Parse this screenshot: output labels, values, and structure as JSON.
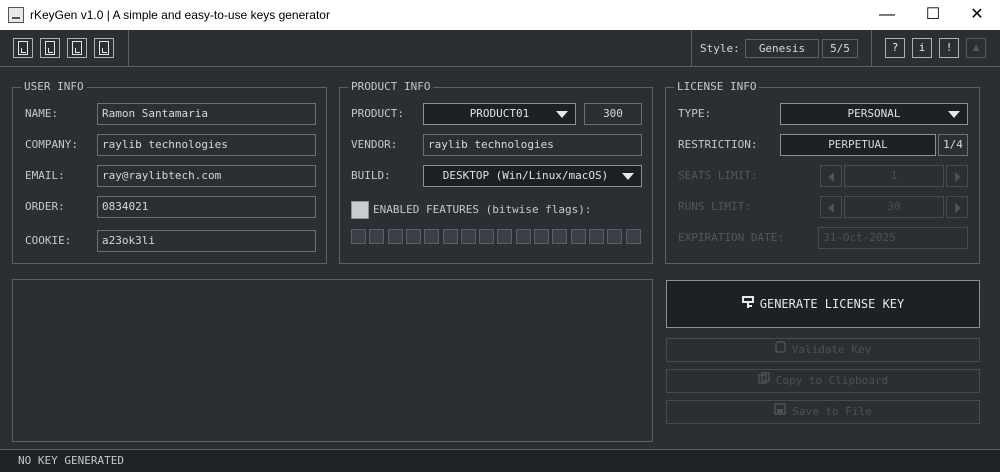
{
  "window": {
    "title": "rKeyGen v1.0 | A simple and easy-to-use keys generator",
    "minimize": "—",
    "maximize": "☐",
    "close": "✕"
  },
  "toolbar": {
    "style_label": "Style:",
    "style_value": "Genesis",
    "style_index": "5/5",
    "help_icon": "?",
    "info_icon": "i",
    "warn_icon": "!"
  },
  "user_info": {
    "title": "USER INFO",
    "name_label": "NAME:",
    "name_value": "Ramon Santamaria",
    "company_label": "COMPANY:",
    "company_value": "raylib technologies",
    "email_label": "EMAIL:",
    "email_value": "ray@raylibtech.com",
    "order_label": "ORDER:",
    "order_value": "0834021",
    "cookie_label": "COOKIE:",
    "cookie_value": "a23ok3li"
  },
  "product_info": {
    "title": "PRODUCT INFO",
    "product_label": "PRODUCT:",
    "product_value": "PRODUCT01",
    "product_number": "300",
    "vendor_label": "VENDOR:",
    "vendor_value": "raylib technologies",
    "build_label": "BUILD:",
    "build_value": "DESKTOP (Win/Linux/macOS)",
    "features_label": "ENABLED FEATURES (bitwise flags):",
    "flags_count": 16
  },
  "license_info": {
    "title": "LICENSE INFO",
    "type_label": "TYPE:",
    "type_value": "PERSONAL",
    "restriction_label": "RESTRICTION:",
    "restriction_value": "PERPETUAL",
    "restriction_index": "1/4",
    "seats_label": "SEATS LIMIT:",
    "seats_value": "1",
    "runs_label": "RUNS LIMIT:",
    "runs_value": "30",
    "expiration_label": "EXPIRATION DATE:",
    "expiration_value": "31-Oct-2025"
  },
  "actions": {
    "generate": "GENERATE LICENSE KEY",
    "validate": "Validate Key",
    "copy": "Copy to Clipboard",
    "save": "Save to File"
  },
  "status": {
    "text": "NO KEY GENERATED"
  },
  "colors": {
    "background": "#2b2f34",
    "border": "#5b6168",
    "text": "#d6d9dc",
    "disabled": "#4c5156",
    "field_dark": "#1d2024"
  }
}
